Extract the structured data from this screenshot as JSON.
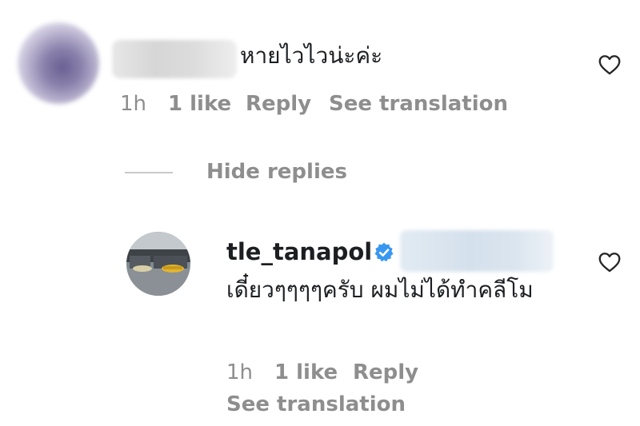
{
  "comment": {
    "text": "หายไวไวน่ะค่ะ",
    "time": "1h",
    "likes": "1 like",
    "reply_label": "Reply",
    "translation_label": "See translation",
    "heart_icon": "heart-outline-icon"
  },
  "thread": {
    "hide_replies_label": "Hide replies"
  },
  "reply": {
    "username": "tle_tanapol",
    "verified_icon": "verified-badge-icon",
    "text": "เดี๋ยวๆๆๆๆครับ ผมไม่ได้ทำคลีโม",
    "time": "1h",
    "likes": "1 like",
    "reply_label": "Reply",
    "translation_label": "See translation",
    "heart_icon": "heart-outline-icon"
  },
  "colors": {
    "text": "#1c1e21",
    "muted": "#8e8e8e",
    "verified": "#3897f0"
  }
}
